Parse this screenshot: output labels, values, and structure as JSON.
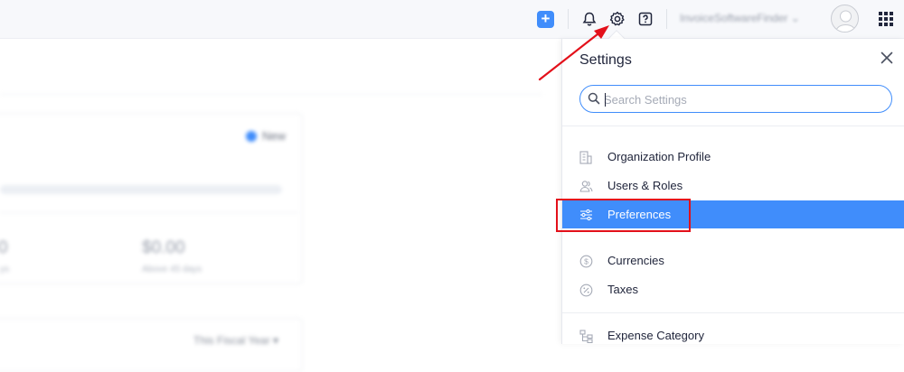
{
  "topbar": {
    "add_icon": "plus-icon",
    "notifications_icon": "bell-icon",
    "settings_icon": "gear-icon",
    "help_icon": "help-icon",
    "organization_name": "InvoiceSoftwareFinder",
    "apps_icon": "grid-icon"
  },
  "background": {
    "badge_label": "New",
    "amount_left": "0",
    "amount_right": "$0.00",
    "caption_left": "ys",
    "caption_right": "Above 45 days",
    "fiscal_filter": "This Fiscal Year ▾"
  },
  "settings_panel": {
    "title": "Settings",
    "close_icon": "close-icon",
    "search": {
      "placeholder": "Search Settings",
      "value": ""
    },
    "items": [
      {
        "label": "Organization Profile",
        "icon": "building-icon",
        "active": false
      },
      {
        "label": "Users & Roles",
        "icon": "users-icon",
        "active": false
      },
      {
        "label": "Preferences",
        "icon": "sliders-icon",
        "active": true
      },
      {
        "label": "Currencies",
        "icon": "dollar-circle-icon",
        "active": false
      },
      {
        "label": "Taxes",
        "icon": "percent-circle-icon",
        "active": false
      },
      {
        "label": "Expense Category",
        "icon": "hierarchy-icon",
        "active": false
      }
    ]
  },
  "colors": {
    "accent": "#408dfb",
    "annotation": "#e3101a"
  }
}
